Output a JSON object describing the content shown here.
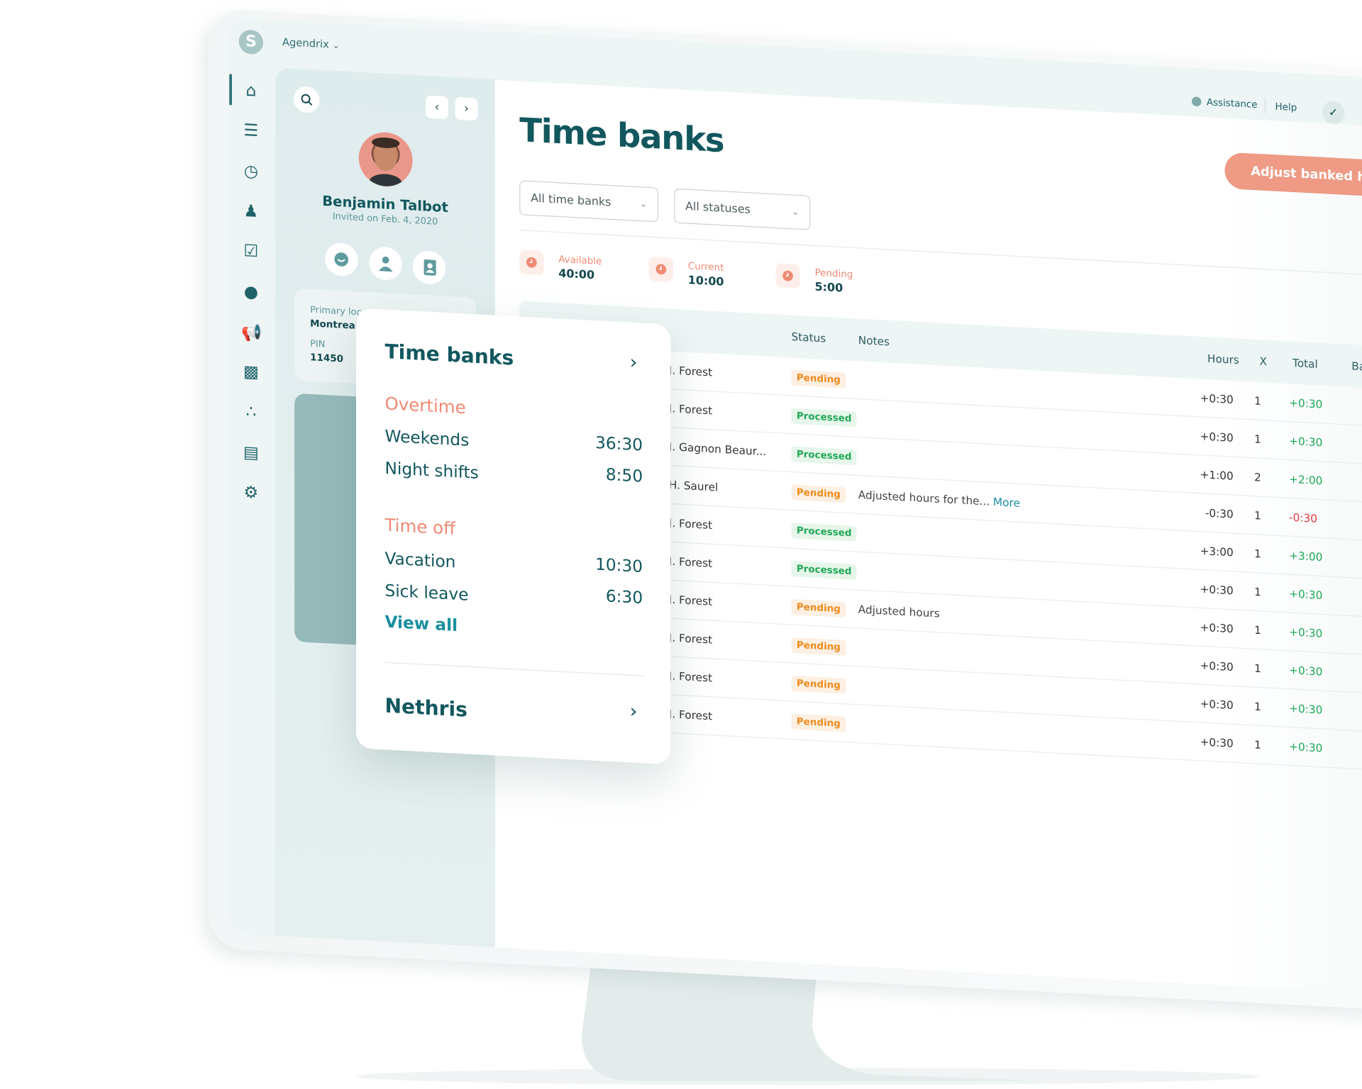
{
  "colors": {
    "brand": "#12575e",
    "accent": "#ef8a73",
    "pending": "#f08a1c",
    "processed": "#21a857",
    "positive": "#21a857",
    "negative": "#e04040",
    "link": "#1a8fa0"
  },
  "topbar": {
    "logo_letter": "S",
    "org_name": "Agendrix",
    "assistance": "Assistance",
    "help": "Help"
  },
  "sidebar": {
    "icons": [
      "home-icon",
      "schedule-icon",
      "time-clock-icon",
      "employees-icon",
      "tasks-icon",
      "messages-icon",
      "announcements-icon",
      "reports-icon",
      "integrations-icon",
      "billing-icon",
      "settings-icon"
    ]
  },
  "profile": {
    "name": "Benjamin Talbot",
    "invited": "Invited on Feb. 4, 2020",
    "primary_location_label": "Primary loc",
    "primary_location": "Montreal",
    "pin_label": "PIN",
    "pin": "11450"
  },
  "main": {
    "title": "Time banks",
    "filter_bank": "All time banks",
    "filter_status": "All statuses",
    "adjust_button": "Adjust banked hour",
    "stats": [
      {
        "label": "Available",
        "value": "40:00"
      },
      {
        "label": "Current",
        "value": "10:00"
      },
      {
        "label": "Pending",
        "value": "5:00"
      }
    ],
    "columns": {
      "status": "Status",
      "notes": "Notes",
      "hours": "Hours",
      "x": "X",
      "total": "Total",
      "balance": "Ba"
    },
    "rows": [
      {
        "name": "J. Forest",
        "status": "Pending",
        "notes": "",
        "more": "",
        "hours": "+0:30",
        "x": "1",
        "total": "+0:30"
      },
      {
        "name": "J. Forest",
        "status": "Processed",
        "notes": "",
        "more": "",
        "hours": "+0:30",
        "x": "1",
        "total": "+0:30"
      },
      {
        "name": "J. Gagnon Beaur...",
        "status": "Processed",
        "notes": "",
        "more": "",
        "hours": "+1:00",
        "x": "2",
        "total": "+2:00"
      },
      {
        "name": "H. Saurel",
        "status": "Pending",
        "notes": "Adjusted hours for the...",
        "more": "More",
        "hours": "-0:30",
        "x": "1",
        "total": "-0:30"
      },
      {
        "name": "J. Forest",
        "status": "Processed",
        "notes": "",
        "more": "",
        "hours": "+3:00",
        "x": "1",
        "total": "+3:00"
      },
      {
        "name": "J. Forest",
        "status": "Processed",
        "notes": "",
        "more": "",
        "hours": "+0:30",
        "x": "1",
        "total": "+0:30"
      },
      {
        "name": "J. Forest",
        "status": "Pending",
        "notes": "Adjusted hours",
        "more": "",
        "hours": "+0:30",
        "x": "1",
        "total": "+0:30"
      },
      {
        "name": "J. Forest",
        "status": "Pending",
        "notes": "",
        "more": "",
        "hours": "+0:30",
        "x": "1",
        "total": "+0:30"
      },
      {
        "name": "J. Forest",
        "status": "Pending",
        "notes": "",
        "more": "",
        "hours": "+0:30",
        "x": "1",
        "total": "+0:30"
      },
      {
        "name": "J. Forest",
        "status": "Pending",
        "notes": "",
        "more": "",
        "hours": "+0:30",
        "x": "1",
        "total": "+0:30"
      }
    ]
  },
  "card": {
    "title": "Time banks",
    "overtime": "Overtime",
    "overtime_items": [
      {
        "label": "Weekends",
        "value": "36:30"
      },
      {
        "label": "Night shifts",
        "value": "8:50"
      }
    ],
    "timeoff": "Time off",
    "timeoff_items": [
      {
        "label": "Vacation",
        "value": "10:30"
      },
      {
        "label": "Sick leave",
        "value": "6:30"
      }
    ],
    "view_all": "View all",
    "nethris": "Nethris"
  }
}
